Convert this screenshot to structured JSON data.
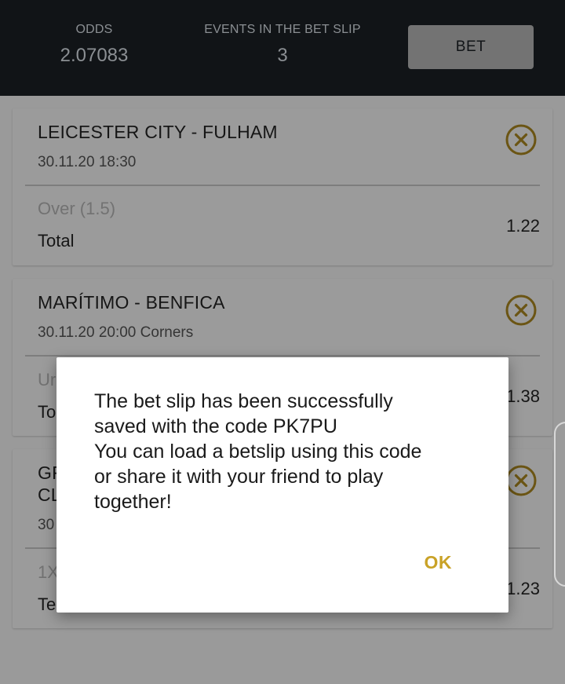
{
  "header": {
    "odds_label": "ODDS",
    "odds_value": "2.07083",
    "events_label": "EVENTS IN THE BET SLIP",
    "events_value": "3",
    "bet_button": "BET"
  },
  "cards": [
    {
      "title": "LEICESTER CITY - FULHAM",
      "subtitle": "30.11.20 18:30",
      "market": "Over (1.5)",
      "type": "Total",
      "odds": "1.22"
    },
    {
      "title": "MARÍTIMO - BENFICA",
      "subtitle": "30.11.20 20:00 Corners",
      "market": "Ur",
      "type": "To",
      "odds": "1.38"
    },
    {
      "title_line1": "GF",
      "title_line2": "CL",
      "subtitle": "30",
      "market": "1X",
      "type": "Te",
      "odds": "1.23"
    }
  ],
  "dialog": {
    "line1": "The bet slip has been successfully",
    "line2": "saved with the code PK7PU",
    "line3": "You can load a betslip using this code",
    "line4": "or share it with your friend to play",
    "line5": "together!",
    "ok": "OK"
  },
  "colors": {
    "accent": "#c9a227",
    "header_bg": "#111417",
    "overlay_bg": "#9a9a9a"
  },
  "icons": {
    "remove": "close-circle-icon"
  }
}
